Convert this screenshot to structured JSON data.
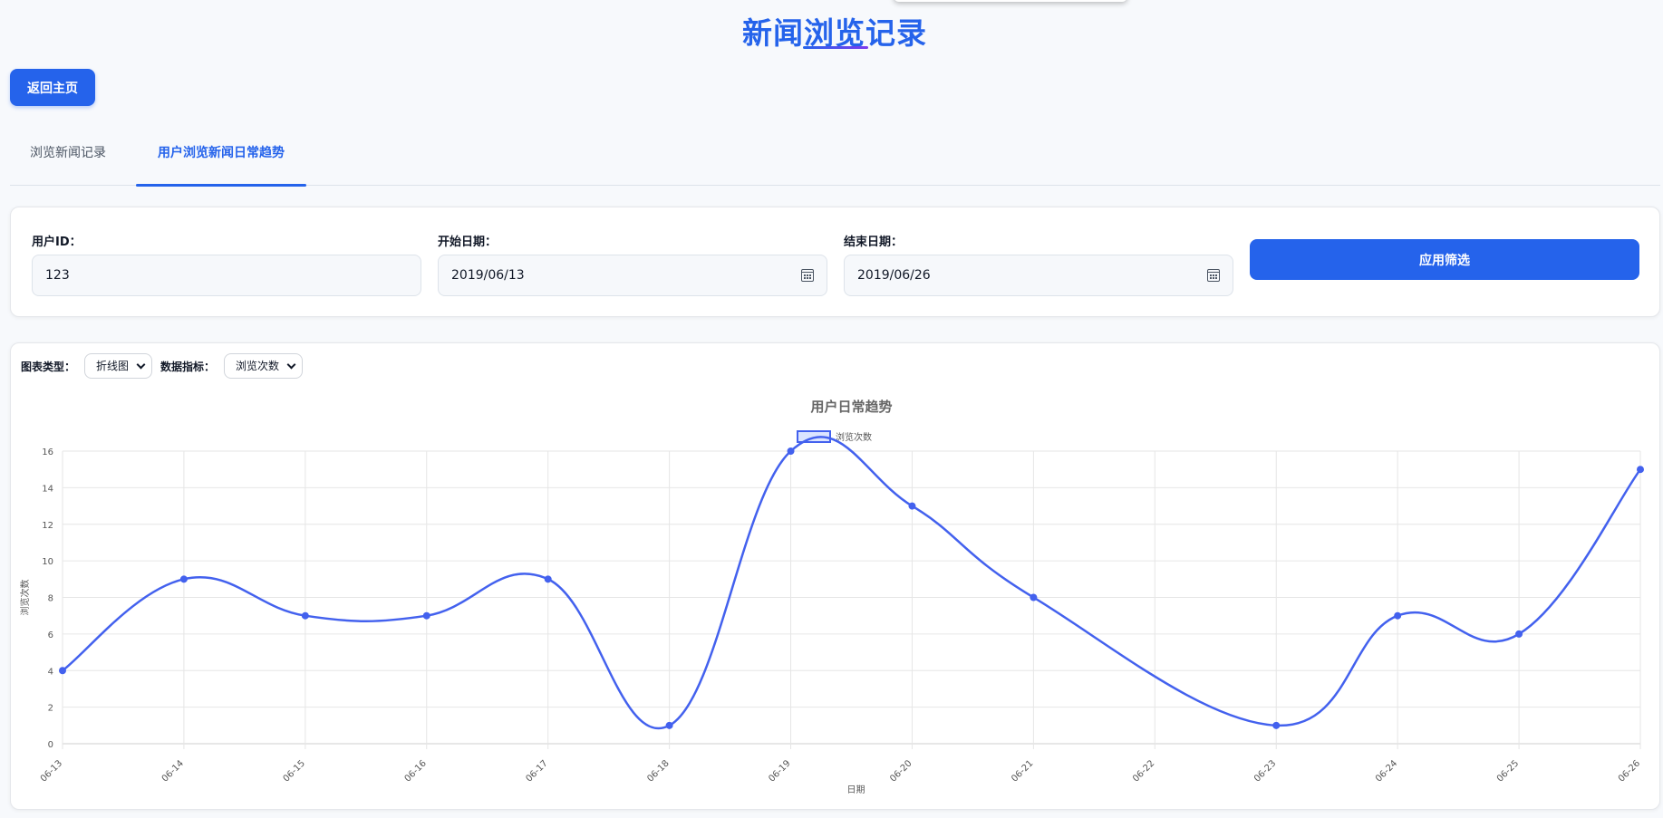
{
  "page": {
    "title": "新闻浏览记录"
  },
  "nav": {
    "home_label": "返回主页"
  },
  "tabs": [
    {
      "label": "浏览新闻记录",
      "active": false
    },
    {
      "label": "用户浏览新闻日常趋势",
      "active": true
    }
  ],
  "filters": {
    "user_id_label": "用户ID：",
    "user_id_value": "123",
    "start_label": "开始日期：",
    "start_value": "2019/06/13",
    "end_label": "结束日期：",
    "end_value": "2019/06/26",
    "apply_label": "应用筛选"
  },
  "chart_controls": {
    "type_label": "图表类型：",
    "type_value": "折线图",
    "metric_label": "数据指标：",
    "metric_value": "浏览次数"
  },
  "colors": {
    "accent": "#2563eb",
    "line": "#4361ee",
    "legend_fill": "#dbe4ff"
  },
  "chart_data": {
    "type": "line",
    "title": "用户日常趋势",
    "xlabel": "日期",
    "ylabel": "浏览次数",
    "categories": [
      "06-13",
      "06-14",
      "06-15",
      "06-16",
      "06-17",
      "06-18",
      "06-19",
      "06-20",
      "06-21",
      "06-22",
      "06-23",
      "06-24",
      "06-25",
      "06-26"
    ],
    "series": [
      {
        "name": "浏览次数",
        "values": [
          4,
          9,
          7,
          7,
          9,
          1,
          16,
          13,
          8,
          null,
          1,
          7,
          6,
          15
        ]
      }
    ],
    "ylim": [
      0,
      16
    ],
    "yticks": [
      "0",
      "2",
      "4",
      "6",
      "8",
      "10",
      "12",
      "14",
      "16"
    ],
    "grid": true,
    "legend": "top-center",
    "smooth": true
  }
}
